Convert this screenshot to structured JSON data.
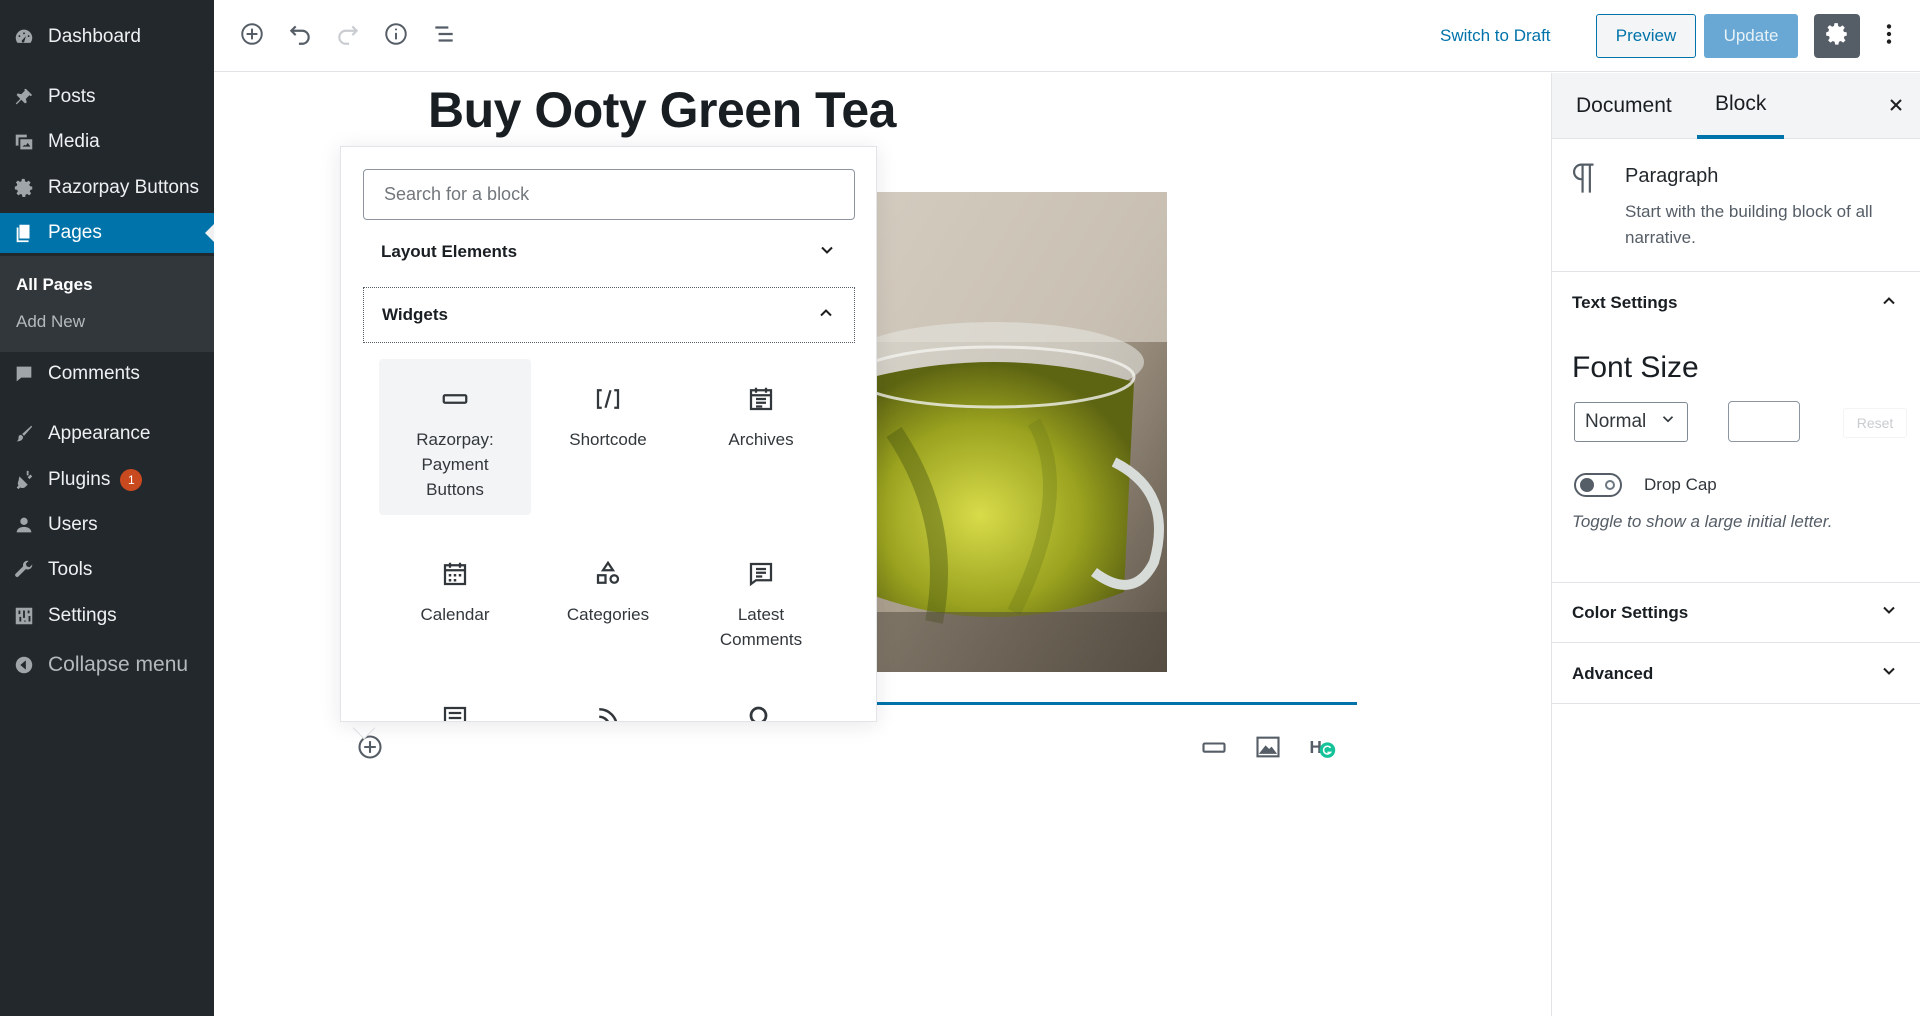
{
  "admin_menu": {
    "items": [
      {
        "label": "Dashboard",
        "icon": "dashboard-icon"
      },
      {
        "label": "Posts",
        "icon": "pin-icon"
      },
      {
        "label": "Media",
        "icon": "media-icon"
      },
      {
        "label": "Razorpay Buttons",
        "icon": "gear-icon"
      },
      {
        "label": "Pages",
        "icon": "pages-icon"
      },
      {
        "label": "Comments",
        "icon": "comment-icon"
      },
      {
        "label": "Appearance",
        "icon": "brush-icon"
      },
      {
        "label": "Plugins",
        "icon": "plugin-icon",
        "badge": "1"
      },
      {
        "label": "Users",
        "icon": "user-icon"
      },
      {
        "label": "Tools",
        "icon": "wrench-icon"
      },
      {
        "label": "Settings",
        "icon": "settings-icon"
      }
    ],
    "submenu": [
      "All Pages",
      "Add New"
    ],
    "collapse_label": "Collapse menu",
    "accent": "#0073aa"
  },
  "toolbar": {
    "switch_to_draft": "Switch to Draft",
    "preview": "Preview",
    "update": "Update",
    "icons": [
      "add-block-icon",
      "undo-icon",
      "redo-icon",
      "info-icon",
      "outline-icon",
      "gear-icon",
      "more-vertical-icon"
    ]
  },
  "editor": {
    "post_title": "Buy Ooty Green Tea"
  },
  "inserter": {
    "search_placeholder": "Search for a block",
    "categories": [
      "Layout Elements",
      "Widgets"
    ],
    "blocks": [
      {
        "label": "Razorpay: Payment Buttons",
        "icon": "button-icon"
      },
      {
        "label": "Shortcode",
        "icon": "shortcode-icon"
      },
      {
        "label": "Archives",
        "icon": "calendar-icon"
      },
      {
        "label": "Calendar",
        "icon": "calendar-icon"
      },
      {
        "label": "Categories",
        "icon": "shapes-icon"
      },
      {
        "label": "Latest Comments",
        "icon": "comment-icon"
      }
    ]
  },
  "settings_sidebar": {
    "tabs": [
      "Document",
      "Block"
    ],
    "active_tab": "Block",
    "block_card": {
      "title": "Paragraph",
      "description": "Start with the building block of all narrative."
    },
    "panels": {
      "text_settings": "Text Settings",
      "color_settings": "Color Settings",
      "advanced": "Advanced"
    },
    "font_size_label": "Font Size",
    "font_size_value": "Normal",
    "custom_size_value": "",
    "reset_label": "Reset",
    "drop_cap_label": "Drop Cap",
    "drop_cap_help": "Toggle to show a large initial letter.",
    "drop_cap_enabled": false
  }
}
